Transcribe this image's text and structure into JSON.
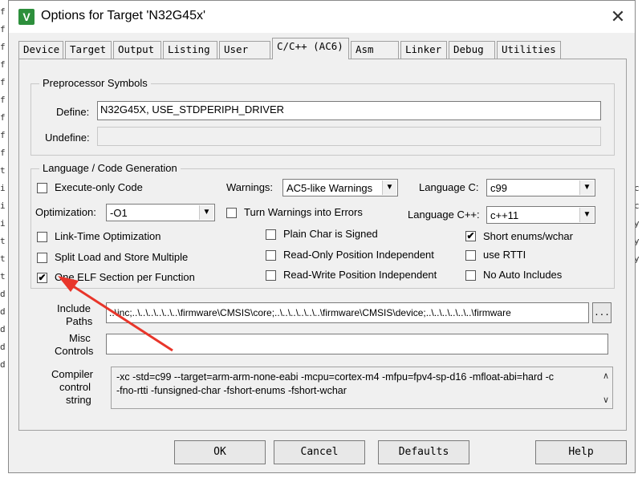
{
  "background_editor": {
    "left_chars": [
      "f",
      "f",
      "f",
      "f",
      "f",
      "f",
      "f",
      "f",
      "f",
      "t",
      "i",
      "i",
      "i",
      "t",
      "t",
      "t",
      "d",
      "d",
      "d",
      "d",
      "d"
    ],
    "right_chars": [
      "c",
      "c",
      "y",
      "y",
      "y"
    ]
  },
  "dialog": {
    "title": "Options for Target 'N32G45x'",
    "close_glyph": "✕",
    "tabs": [
      "Device",
      "Target",
      "Output",
      "Listing",
      "User",
      "C/C++ (AC6)",
      "Asm",
      "Linker",
      "Debug",
      "Utilities"
    ],
    "active_tab": "C/C++ (AC6)"
  },
  "preprocessor": {
    "legend": "Preprocessor Symbols",
    "define_label": "Define:",
    "define_value": "N32G45X, USE_STDPERIPH_DRIVER",
    "undefine_label": "Undefine:",
    "undefine_value": ""
  },
  "language": {
    "legend": "Language / Code Generation",
    "execute_only": "Execute-only Code",
    "warnings_label": "Warnings:",
    "warnings_value": "AC5-like Warnings",
    "lang_c_label": "Language C:",
    "lang_c_value": "c99",
    "optimization_label": "Optimization:",
    "optimization_value": "-O1",
    "turn_warnings": "Turn Warnings into Errors",
    "lang_cpp_label": "Language C++:",
    "lang_cpp_value": "c++11",
    "lto": "Link-Time Optimization",
    "plain_char": "Plain Char is Signed",
    "short_enums": "Short enums/wchar",
    "split_load": "Split Load and Store Multiple",
    "ropi": "Read-Only Position Independent",
    "rtti": "use RTTI",
    "one_elf": "One ELF Section per Function",
    "rwpi": "Read-Write Position Independent",
    "no_auto": "No Auto Includes",
    "check_glyph": "✔"
  },
  "include": {
    "label_line1": "Include",
    "label_line2": "Paths",
    "value": "..\\inc;..\\..\\..\\..\\..\\..\\firmware\\CMSIS\\core;..\\..\\..\\..\\..\\..\\firmware\\CMSIS\\device;..\\..\\..\\..\\..\\..\\firmware",
    "browse": "..."
  },
  "misc": {
    "label_line1": "Misc",
    "label_line2": "Controls",
    "value": ""
  },
  "compiler": {
    "label_line1": "Compiler",
    "label_line2": "control",
    "label_line3": "string",
    "line1": "-xc -std=c99 --target=arm-arm-none-eabi -mcpu=cortex-m4 -mfpu=fpv4-sp-d16 -mfloat-abi=hard -c",
    "line2": "-fno-rtti -funsigned-char -fshort-enums -fshort-wchar",
    "scroll_up": "∧",
    "scroll_down": "∨"
  },
  "buttons": {
    "ok": "OK",
    "cancel": "Cancel",
    "defaults": "Defaults",
    "help": "Help"
  },
  "colors": {
    "annotation_arrow": "#e8352a"
  }
}
